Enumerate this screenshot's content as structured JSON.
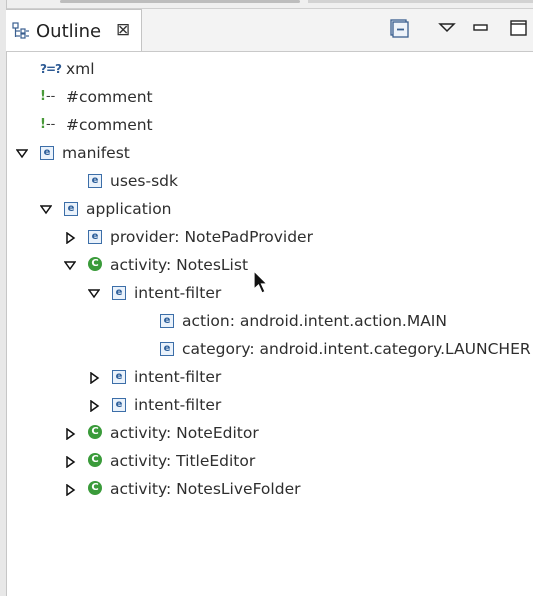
{
  "view": {
    "title": "Outline",
    "close_glyph": "⊠",
    "toolbar": [
      {
        "name": "collapse-all-button",
        "icon": "collapse-all-icon"
      },
      {
        "name": "view-menu-button",
        "icon": "view-menu-icon"
      },
      {
        "name": "minimize-button",
        "icon": "minimize-icon"
      },
      {
        "name": "maximize-button",
        "icon": "maximize-icon"
      }
    ]
  },
  "tree": {
    "nodes": [
      {
        "label": "xml",
        "icon": "xml-declaration-icon",
        "icon_text": "?=?",
        "depth": 1,
        "twisty": "none"
      },
      {
        "label": "#comment",
        "icon": "comment-icon",
        "icon_text": "!--",
        "depth": 1,
        "twisty": "none"
      },
      {
        "label": "#comment",
        "icon": "comment-icon",
        "icon_text": "!--",
        "depth": 1,
        "twisty": "none"
      },
      {
        "label": "manifest",
        "icon": "element-icon",
        "icon_text": "e",
        "depth": 0,
        "twisty": "expanded"
      },
      {
        "label": "uses-sdk",
        "icon": "element-icon",
        "icon_text": "e",
        "depth": 2,
        "twisty": "none"
      },
      {
        "label": "application",
        "icon": "element-icon",
        "icon_text": "e",
        "depth": 1,
        "twisty": "expanded"
      },
      {
        "label": "provider: NotePadProvider",
        "icon": "element-icon",
        "icon_text": "e",
        "depth": 2,
        "twisty": "collapsed"
      },
      {
        "label": "activity: NotesList",
        "icon": "class-icon",
        "icon_text": "C",
        "depth": 2,
        "twisty": "expanded"
      },
      {
        "label": "intent-filter",
        "icon": "element-icon",
        "icon_text": "e",
        "depth": 3,
        "twisty": "expanded"
      },
      {
        "label": "action: android.intent.action.MAIN",
        "icon": "element-icon",
        "icon_text": "e",
        "depth": 5,
        "twisty": "none"
      },
      {
        "label": "category: android.intent.category.LAUNCHER",
        "icon": "element-icon",
        "icon_text": "e",
        "depth": 5,
        "twisty": "none"
      },
      {
        "label": "intent-filter",
        "icon": "element-icon",
        "icon_text": "e",
        "depth": 3,
        "twisty": "collapsed"
      },
      {
        "label": "intent-filter",
        "icon": "element-icon",
        "icon_text": "e",
        "depth": 3,
        "twisty": "collapsed"
      },
      {
        "label": "activity: NoteEditor",
        "icon": "class-icon",
        "icon_text": "C",
        "depth": 2,
        "twisty": "collapsed"
      },
      {
        "label": "activity: TitleEditor",
        "icon": "class-icon",
        "icon_text": "C",
        "depth": 2,
        "twisty": "collapsed"
      },
      {
        "label": "activity: NotesLiveFolder",
        "icon": "class-icon",
        "icon_text": "C",
        "depth": 2,
        "twisty": "collapsed"
      }
    ]
  },
  "colors": {
    "element_icon": "#3c6ea8",
    "class_icon": "#3a9b3a",
    "text": "#2e2e2e"
  }
}
